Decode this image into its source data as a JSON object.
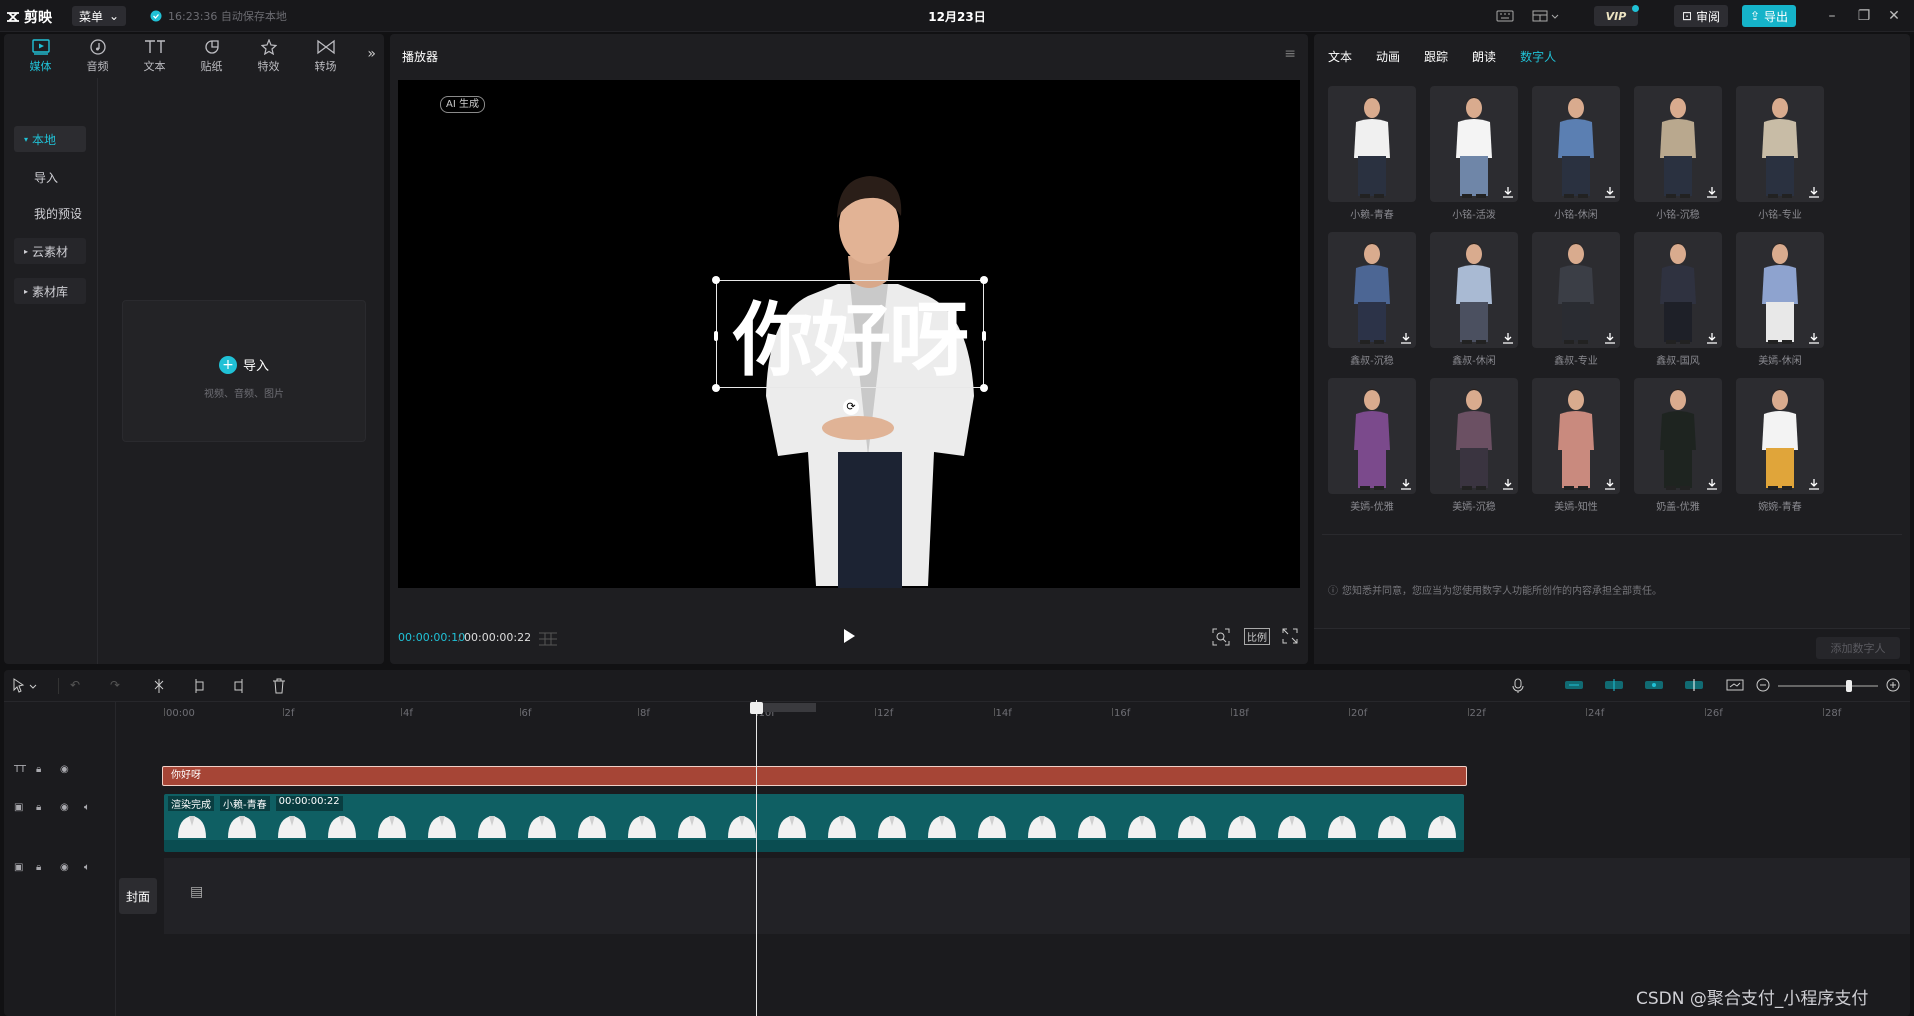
{
  "app": {
    "name": "剪映",
    "menu_label": "菜单",
    "autosave": "16:23:36 自动保存本地",
    "date": "12月23日",
    "vip_label": "VIP",
    "review_label": "审阅",
    "export_label": "导出"
  },
  "media_panel": {
    "tabs": [
      {
        "label": "媒体",
        "icon": "media-icon"
      },
      {
        "label": "音频",
        "icon": "audio-icon"
      },
      {
        "label": "文本",
        "icon": "text-icon"
      },
      {
        "label": "贴纸",
        "icon": "sticker-icon"
      },
      {
        "label": "特效",
        "icon": "effects-icon"
      },
      {
        "label": "转场",
        "icon": "transition-icon"
      }
    ],
    "sidebar": {
      "local": "本地",
      "import": "导入",
      "presets": "我的预设",
      "cloud": "云素材",
      "library": "素材库"
    },
    "import_box": {
      "label": "导入",
      "sub": "视频、音频、图片"
    }
  },
  "player": {
    "title": "播放器",
    "ai_badge": "AI 生成",
    "subtitle": "你好呀",
    "time_current": "00:00:00:10",
    "time_total": "00:00:00:22",
    "ratio_label": "比例"
  },
  "digital_human": {
    "tabs": [
      "文本",
      "动画",
      "跟踪",
      "朗读",
      "数字人"
    ],
    "active_tab": "数字人",
    "avatars": [
      "小赖-青春",
      "小铭-活泼",
      "小铭-休闲",
      "小铭-沉稳",
      "小铭-专业",
      "鑫叔-沉稳",
      "鑫叔-休闲",
      "鑫叔-专业",
      "鑫叔-国风",
      "美嫣-休闲",
      "美嫣-优雅",
      "美嫣-沉稳",
      "美嫣-知性",
      "奶盖-优雅",
      "婉婉-青春"
    ],
    "notice": "您知悉并同意，您应当为您使用数字人功能所创作的内容承担全部责任。",
    "add_button": "添加数字人"
  },
  "timeline": {
    "ruler": [
      "00:00",
      "2f",
      "4f",
      "6f",
      "8f",
      "10f",
      "12f",
      "14f",
      "16f",
      "18f",
      "20f",
      "22f",
      "24f",
      "26f",
      "28f"
    ],
    "text_clip": "你好呀",
    "video_clip": {
      "status": "渲染完成",
      "name": "小赖-青春",
      "duration": "00:00:00:22"
    },
    "cover_label": "封面"
  },
  "watermark": "CSDN @聚合支付_小程序支付"
}
